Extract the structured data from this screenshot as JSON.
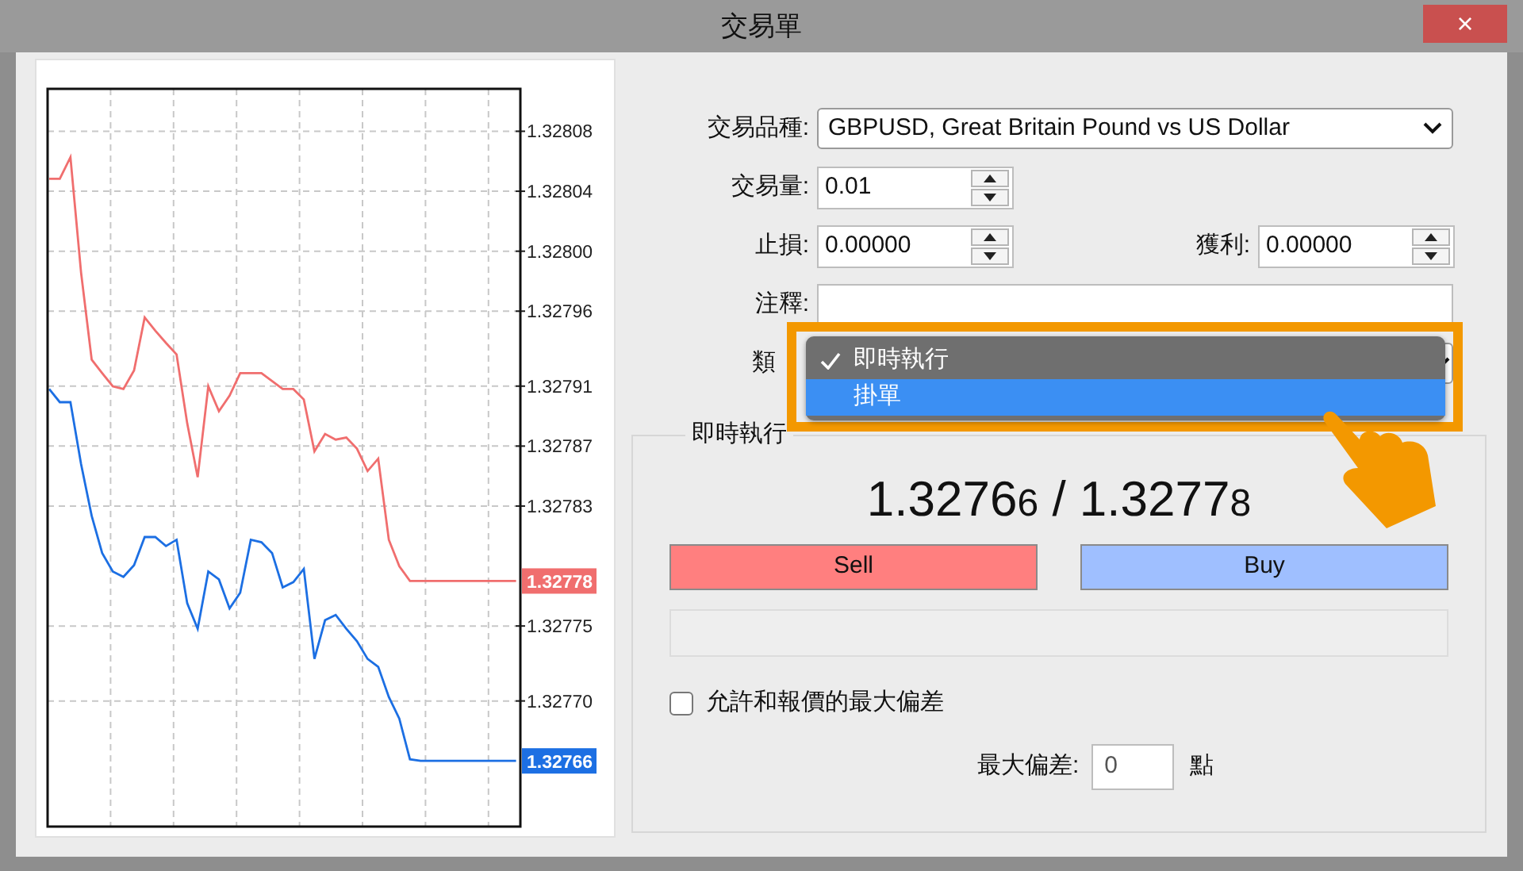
{
  "window": {
    "title": "交易單",
    "close": "×"
  },
  "chart": {
    "chart_data": {
      "type": "line",
      "categories": [
        null,
        null,
        null,
        null,
        null,
        null,
        null,
        null,
        null,
        null,
        null,
        null,
        null,
        null,
        null,
        null,
        null,
        null,
        null,
        null,
        null,
        null,
        null,
        null,
        null,
        null,
        null,
        null,
        null,
        null,
        null,
        null,
        null,
        null,
        null,
        null,
        null,
        null,
        null,
        null,
        null,
        null,
        null,
        null,
        null
      ],
      "series": [
        {
          "color": "#f06e6e",
          "values": [
            1.3280483,
            1.3280483,
            1.3280627,
            1.3279858,
            1.3279276,
            1.3279187,
            1.3279099,
            1.3279081,
            1.3279205,
            1.3279558,
            1.327947,
            1.3279389,
            1.3279311,
            1.3278852,
            1.3278492,
            1.3279099,
            1.3278933,
            1.3279036,
            1.3279187,
            1.3279187,
            1.3279187,
            1.3279134,
            1.3279081,
            1.3279081,
            1.3279011,
            1.3278665,
            1.3278781,
            1.3278743,
            1.3278757,
            1.3278683,
            1.3278534,
            1.3278616,
            1.3278075,
            1.3277899,
            1.32778,
            1.32778,
            1.32778,
            1.32778,
            1.32778,
            1.32778,
            1.32778,
            1.32778,
            1.32778,
            1.32778,
            1.32778
          ]
        },
        {
          "color": "#1c6fe3",
          "values": [
            1.3279081,
            1.3278993,
            1.3278993,
            1.327858,
            1.3278234,
            1.3277987,
            1.3277864,
            1.3277828,
            1.3277906,
            1.3278093,
            1.3278093,
            1.3278033,
            1.3278075,
            1.3277652,
            1.3277482,
            1.3277864,
            1.3277811,
            1.3277617,
            1.3277722,
            1.3278075,
            1.3278058,
            1.3277987,
            1.3277758,
            1.3277793,
            1.3277881,
            1.3277281,
            1.3277539,
            1.3277574,
            1.3277482,
            1.3277398,
            1.3277281,
            1.3277228,
            1.3277027,
            1.3276882,
            1.3276611,
            1.32766,
            1.32766,
            1.32766,
            1.32766,
            1.32766,
            1.32766,
            1.32766,
            1.32766,
            1.32766,
            1.32766
          ]
        }
      ],
      "ylim": [
        1.3276162,
        1.3281083
      ],
      "grid": true,
      "yticks": [
        {
          "value": 1.32808,
          "label": "1.32808"
        },
        {
          "value": 1.32804,
          "label": "1.32804"
        },
        {
          "value": 1.328,
          "label": "1.32800"
        },
        {
          "value": 1.32796,
          "label": "1.32796"
        },
        {
          "value": 1.32791,
          "label": "1.32791"
        },
        {
          "value": 1.32787,
          "label": "1.32787"
        },
        {
          "value": 1.32783,
          "label": "1.32783"
        },
        {
          "value": 1.32775,
          "label": "1.32775"
        },
        {
          "value": 1.3277,
          "label": "1.32770"
        }
      ]
    },
    "price_tags": [
      {
        "text": "1.32778",
        "color": "#f06e6e"
      },
      {
        "text": "1.32766",
        "color": "#1c6fe3"
      }
    ]
  },
  "form": {
    "rows": [
      {
        "fields": [
          {
            "kind": "select",
            "label": "交易品種:",
            "value": "GBPUSD, Great Britain Pound vs US Dollar"
          }
        ]
      },
      {
        "fields": [
          {
            "kind": "spinner",
            "label": "交易量:",
            "value": "0.01"
          }
        ]
      },
      {
        "fields": [
          {
            "kind": "spinner",
            "label": "止損:",
            "value": "0.00000"
          },
          {
            "kind": "spinner",
            "label": "獲利:",
            "value": "0.00000"
          }
        ]
      },
      {
        "fields": [
          {
            "kind": "text",
            "label": "注釋:"
          }
        ]
      },
      {
        "fields": [
          {
            "kind": "select",
            "label": "類"
          }
        ]
      }
    ]
  },
  "type_menu": {
    "items": [
      {
        "label": "即時執行",
        "checked": true,
        "selected": false
      },
      {
        "label": "掛單",
        "checked": false,
        "selected": true
      }
    ]
  },
  "execution": {
    "title": "即時執行",
    "quote": {
      "bid": "1.3276",
      "bid_last": "6",
      "separator": "/",
      "ask": "1.3277",
      "ask_last": "8"
    },
    "buttons": [
      {
        "kind": "sell",
        "label": "Sell"
      },
      {
        "kind": "buy",
        "label": "Buy"
      }
    ],
    "deviation_checkbox": {
      "label": "允許和報價的最大偏差",
      "checked": false
    },
    "max_deviation": {
      "label": "最大偏差:",
      "value": "0",
      "unit": "點"
    }
  }
}
